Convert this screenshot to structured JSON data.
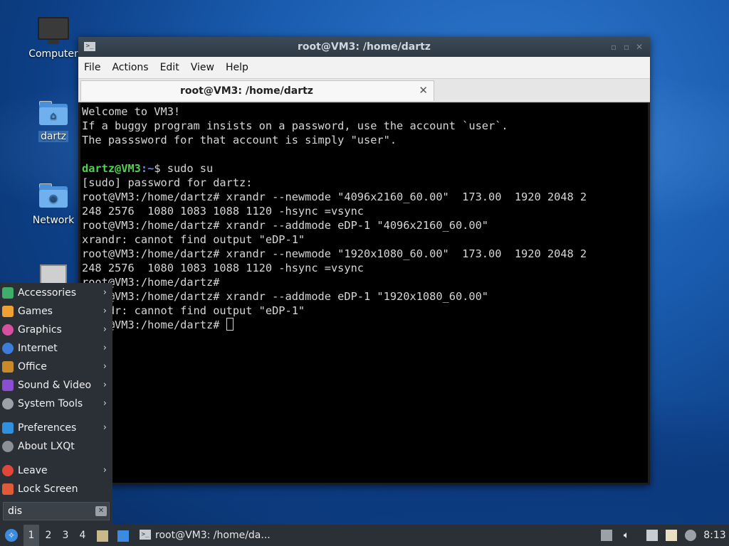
{
  "desktop": {
    "icons": [
      {
        "label": "Computer",
        "icon": "computer-icon"
      },
      {
        "label": "dartz",
        "icon": "home-folder-icon"
      },
      {
        "label": "Network",
        "icon": "network-folder-icon"
      },
      {
        "label": "",
        "icon": "trash-icon"
      }
    ]
  },
  "terminal": {
    "window_title": "root@VM3: /home/dartz",
    "menu": [
      "File",
      "Actions",
      "Edit",
      "View",
      "Help"
    ],
    "tab_label": "root@VM3: /home/dartz",
    "lines": [
      "Welcome to VM3!",
      "If a buggy program insists on a password, use the account `user`.",
      "The passsword for that account is simply \"user\".",
      "",
      "",
      "[sudo] password for dartz:",
      "root@VM3:/home/dartz# xrandr --newmode \"4096x2160_60.00\"  173.00  1920 2048 2",
      "248 2576  1080 1083 1088 1120 -hsync =vsync",
      "root@VM3:/home/dartz# xrandr --addmode eDP-1 \"4096x2160_60.00\"",
      "xrandr: cannot find output \"eDP-1\"",
      "root@VM3:/home/dartz# xrandr --newmode \"1920x1080_60.00\"  173.00  1920 2048 2",
      "248 2576  1080 1083 1088 1120 -hsync =vsync",
      "root@VM3:/home/dartz#",
      "root@VM3:/home/dartz# xrandr --addmode eDP-1 \"1920x1080_60.00\"",
      "xrandr: cannot find output \"eDP-1\"",
      "root@VM3:/home/dartz# "
    ],
    "prompt_user": "dartz@VM3",
    "prompt_path": ":~",
    "prompt_cmd": "$ sudo su"
  },
  "app_menu": {
    "items": [
      {
        "label": "Accessories",
        "icon": "accessories-icon",
        "color": "#3fae6a",
        "submenu": true
      },
      {
        "label": "Games",
        "icon": "games-icon",
        "color": "#f0a030",
        "submenu": true
      },
      {
        "label": "Graphics",
        "icon": "graphics-icon",
        "color": "#d94fa0",
        "submenu": true
      },
      {
        "label": "Internet",
        "icon": "internet-icon",
        "color": "#3b7dd8",
        "submenu": true
      },
      {
        "label": "Office",
        "icon": "office-icon",
        "color": "#c98a2a",
        "submenu": true
      },
      {
        "label": "Sound & Video",
        "icon": "sound-video-icon",
        "color": "#8a4fd0",
        "submenu": true
      },
      {
        "label": "System Tools",
        "icon": "system-tools-icon",
        "color": "#9aa1a8",
        "submenu": true
      },
      {
        "label": "Preferences",
        "icon": "preferences-icon",
        "color": "#2f8fe0",
        "submenu": true
      },
      {
        "label": "About LXQt",
        "icon": "about-icon",
        "color": "#8a9098",
        "submenu": false
      },
      {
        "label": "Leave",
        "icon": "power-icon",
        "color": "#e0473a",
        "submenu": true
      },
      {
        "label": "Lock Screen",
        "icon": "lock-icon",
        "color": "#e05a3a",
        "submenu": false
      }
    ],
    "search_value": "dis"
  },
  "taskbar": {
    "workspaces": [
      "1",
      "2",
      "3",
      "4"
    ],
    "task_label": "root@VM3: /home/da...",
    "clock": "8:13"
  }
}
